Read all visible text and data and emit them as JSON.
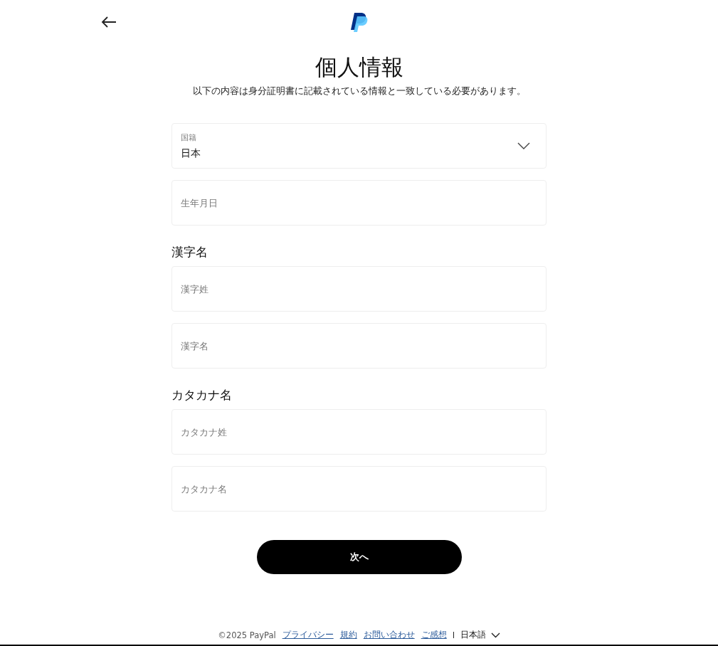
{
  "header": {
    "title": "個人情報",
    "subtitle": "以下の内容は身分証明書に記載されている情報と一致している必要があります。"
  },
  "sections": [
    {
      "fields": [
        {
          "kind": "select",
          "label": "国籍",
          "value": "日本"
        },
        {
          "kind": "input",
          "placeholder": "生年月日"
        }
      ]
    },
    {
      "heading": "漢字名",
      "fields": [
        {
          "kind": "input",
          "placeholder": "漢字姓"
        },
        {
          "kind": "input",
          "placeholder": "漢字名"
        }
      ]
    },
    {
      "heading": "カタカナ名",
      "fields": [
        {
          "kind": "input",
          "placeholder": "カタカナ姓"
        },
        {
          "kind": "input",
          "placeholder": "カタカナ名"
        }
      ]
    }
  ],
  "next_button": "次へ",
  "footer": {
    "copyright": "©2025 PayPal",
    "links": [
      "プライバシー",
      "規約",
      "お問い合わせ",
      "ご感想"
    ],
    "language": "日本語"
  }
}
